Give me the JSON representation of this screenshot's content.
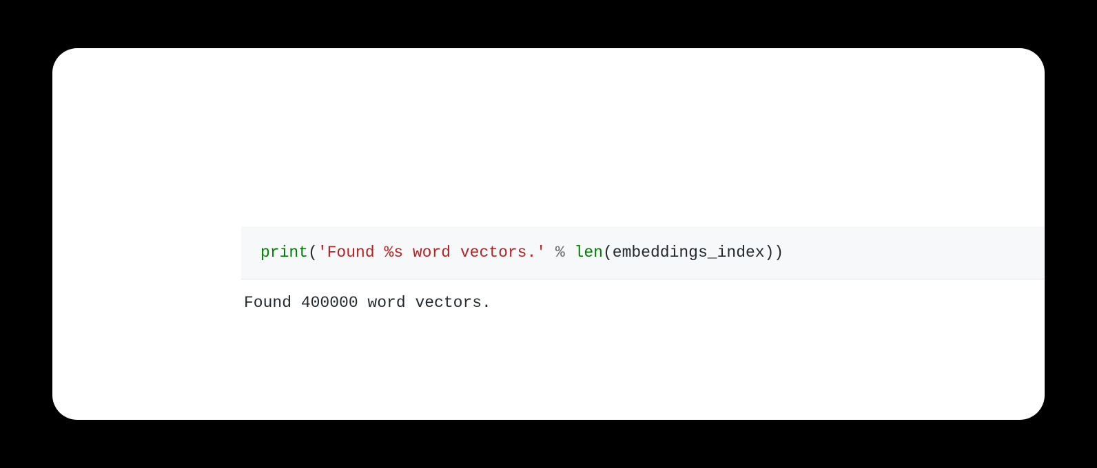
{
  "code": {
    "print": "print",
    "open_paren1": "(",
    "string": "'Found %s word vectors.'",
    "space1": " ",
    "percent": "%",
    "space2": " ",
    "len": "len",
    "open_paren2": "(",
    "arg": "embeddings_index",
    "close_paren2": ")",
    "close_paren1": ")"
  },
  "output": "Found 400000 word vectors."
}
